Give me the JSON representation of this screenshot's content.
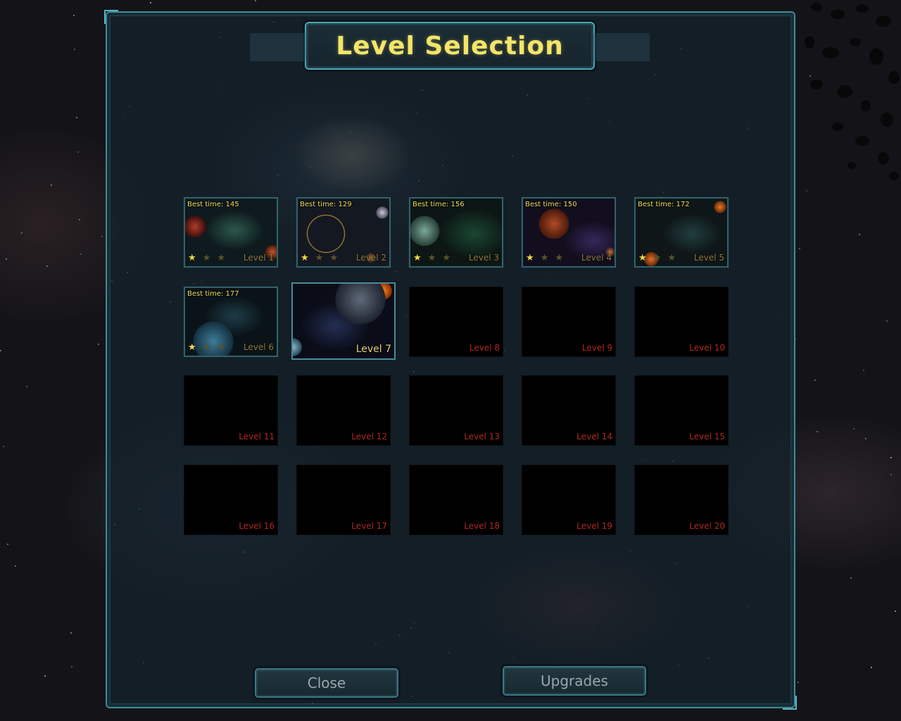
{
  "title": "Level Selection",
  "colors": {
    "title_text": "#f3e46a",
    "panel_border": "#3f8a98",
    "best_time_text": "#f0de5a",
    "locked_label": "#b0281e",
    "star_earned": "#f3d84a",
    "star_empty": "#5b5428"
  },
  "levels": [
    {
      "label": "Level 1",
      "best_time": "Best time: 145",
      "stars_earned": 1,
      "stars_total": 3,
      "status": "unlocked"
    },
    {
      "label": "Level 2",
      "best_time": "Best time: 129",
      "stars_earned": 1,
      "stars_total": 3,
      "status": "unlocked"
    },
    {
      "label": "Level 3",
      "best_time": "Best time: 156",
      "stars_earned": 1,
      "stars_total": 3,
      "status": "unlocked"
    },
    {
      "label": "Level 4",
      "best_time": "Best time: 150",
      "stars_earned": 1,
      "stars_total": 3,
      "status": "unlocked"
    },
    {
      "label": "Level 5",
      "best_time": "Best time: 172",
      "stars_earned": 1,
      "stars_total": 3,
      "status": "unlocked"
    },
    {
      "label": "Level 6",
      "best_time": "Best time: 177",
      "stars_earned": 1,
      "stars_total": 3,
      "status": "unlocked"
    },
    {
      "label": "Level 7",
      "status": "current"
    },
    {
      "label": "Level 8",
      "status": "locked"
    },
    {
      "label": "Level 9",
      "status": "locked"
    },
    {
      "label": "Level 10",
      "status": "locked"
    },
    {
      "label": "Level 11",
      "status": "locked"
    },
    {
      "label": "Level 12",
      "status": "locked"
    },
    {
      "label": "Level 13",
      "status": "locked"
    },
    {
      "label": "Level 14",
      "status": "locked"
    },
    {
      "label": "Level 15",
      "status": "locked"
    },
    {
      "label": "Level 16",
      "status": "locked"
    },
    {
      "label": "Level 17",
      "status": "locked"
    },
    {
      "label": "Level 18",
      "status": "locked"
    },
    {
      "label": "Level 19",
      "status": "locked"
    },
    {
      "label": "Level 20",
      "status": "locked"
    }
  ],
  "buttons": {
    "close": "Close",
    "upgrades": "Upgrades"
  }
}
